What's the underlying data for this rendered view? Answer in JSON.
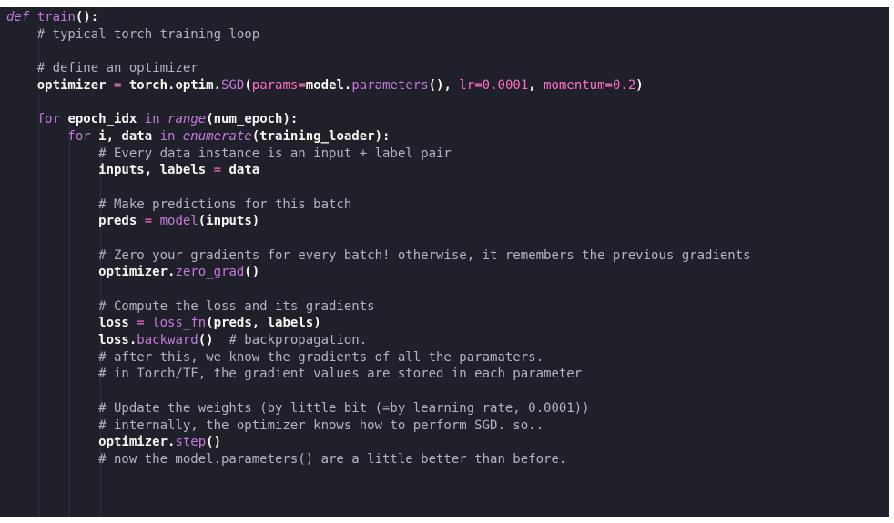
{
  "editor": {
    "lines": [
      [
        {
          "t": "def",
          "c": "kw-it"
        },
        {
          "t": " ",
          "c": "name"
        },
        {
          "t": "train",
          "c": "fn"
        },
        {
          "t": "():",
          "c": "punc"
        }
      ],
      [
        {
          "t": "    # typical torch training loop",
          "c": "comment"
        }
      ],
      [],
      [
        {
          "t": "    # define an optimizer",
          "c": "comment"
        }
      ],
      [
        {
          "t": "    optimizer ",
          "c": "bold"
        },
        {
          "t": "=",
          "c": "op"
        },
        {
          "t": " torch.optim.",
          "c": "bold"
        },
        {
          "t": "SGD",
          "c": "method"
        },
        {
          "t": "(",
          "c": "punc"
        },
        {
          "t": "params",
          "c": "kwarg"
        },
        {
          "t": "=",
          "c": "op"
        },
        {
          "t": "model.",
          "c": "bold"
        },
        {
          "t": "parameters",
          "c": "method"
        },
        {
          "t": "(), ",
          "c": "punc"
        },
        {
          "t": "lr",
          "c": "kwarg"
        },
        {
          "t": "=",
          "c": "op"
        },
        {
          "t": "0.0001",
          "c": "num"
        },
        {
          "t": ", ",
          "c": "punc"
        },
        {
          "t": "momentum",
          "c": "kwarg"
        },
        {
          "t": "=",
          "c": "op"
        },
        {
          "t": "0.2",
          "c": "num"
        },
        {
          "t": ")",
          "c": "punc"
        }
      ],
      [],
      [
        {
          "t": "    for",
          "c": "kw"
        },
        {
          "t": " epoch_idx ",
          "c": "bold"
        },
        {
          "t": "in",
          "c": "kw"
        },
        {
          "t": " ",
          "c": "name"
        },
        {
          "t": "range",
          "c": "builtin-it"
        },
        {
          "t": "(num_epoch):",
          "c": "punc"
        }
      ],
      [
        {
          "t": "        for",
          "c": "kw"
        },
        {
          "t": " i, data ",
          "c": "bold"
        },
        {
          "t": "in",
          "c": "kw"
        },
        {
          "t": " ",
          "c": "name"
        },
        {
          "t": "enumerate",
          "c": "builtin-it"
        },
        {
          "t": "(training_loader):",
          "c": "punc"
        }
      ],
      [
        {
          "t": "            # Every data instance is an input + label pair",
          "c": "comment"
        }
      ],
      [
        {
          "t": "            inputs, labels ",
          "c": "bold"
        },
        {
          "t": "=",
          "c": "op"
        },
        {
          "t": " data",
          "c": "bold"
        }
      ],
      [],
      [
        {
          "t": "            # Make predictions for this batch",
          "c": "comment"
        }
      ],
      [
        {
          "t": "            preds ",
          "c": "bold"
        },
        {
          "t": "=",
          "c": "op"
        },
        {
          "t": " ",
          "c": "name"
        },
        {
          "t": "model",
          "c": "method"
        },
        {
          "t": "(inputs)",
          "c": "punc"
        }
      ],
      [],
      [
        {
          "t": "            # Zero your gradients for every batch! otherwise, it remembers the previous gradients",
          "c": "comment"
        }
      ],
      [
        {
          "t": "            optimizer.",
          "c": "bold"
        },
        {
          "t": "zero_grad",
          "c": "method"
        },
        {
          "t": "()",
          "c": "punc"
        }
      ],
      [],
      [
        {
          "t": "            # Compute the loss and its gradients",
          "c": "comment"
        }
      ],
      [
        {
          "t": "            loss ",
          "c": "bold"
        },
        {
          "t": "=",
          "c": "op"
        },
        {
          "t": " ",
          "c": "name"
        },
        {
          "t": "loss_fn",
          "c": "method"
        },
        {
          "t": "(preds, labels)",
          "c": "punc"
        }
      ],
      [
        {
          "t": "            loss.",
          "c": "bold"
        },
        {
          "t": "backward",
          "c": "method"
        },
        {
          "t": "()",
          "c": "punc"
        },
        {
          "t": "  # backpropagation.",
          "c": "comment"
        }
      ],
      [
        {
          "t": "            # after this, we know the gradients of all the paramaters.",
          "c": "comment"
        }
      ],
      [
        {
          "t": "            # in Torch/TF, the gradient values are stored in each parameter",
          "c": "comment"
        }
      ],
      [],
      [
        {
          "t": "            # Update the weights (by little bit (=by learning rate, 0.0001))",
          "c": "comment"
        }
      ],
      [
        {
          "t": "            # internally, the optimizer knows how to perform SGD. so..",
          "c": "comment"
        }
      ],
      [
        {
          "t": "            optimizer.",
          "c": "bold"
        },
        {
          "t": "step",
          "c": "method"
        },
        {
          "t": "()",
          "c": "punc"
        }
      ],
      [
        {
          "t": "            # now the model.parameters() are a little better than before.",
          "c": "comment"
        }
      ]
    ]
  },
  "colors": {
    "background": "#1f2029",
    "keyword": "#c678dd",
    "operator": "#ff6ec7",
    "comment": "#b3b3c2",
    "text": "#f8f8f2"
  }
}
